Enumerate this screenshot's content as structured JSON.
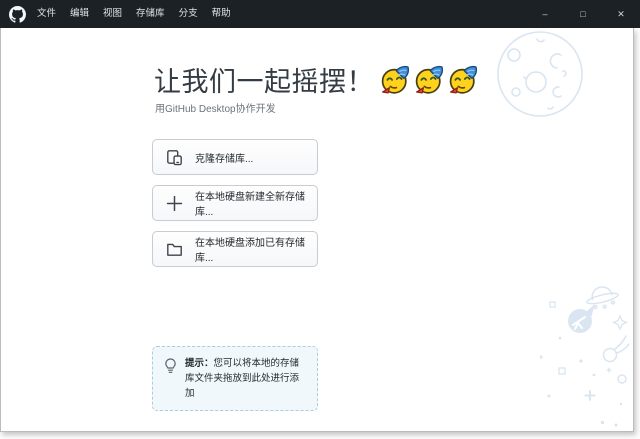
{
  "window": {
    "logo_icon": "github-octocat-logo",
    "menus": [
      {
        "label": "文件"
      },
      {
        "label": "编辑"
      },
      {
        "label": "视图"
      },
      {
        "label": "存储库"
      },
      {
        "label": "分支"
      },
      {
        "label": "帮助"
      }
    ],
    "controls": {
      "minimize": "–",
      "maximize": "□",
      "close": "✕"
    }
  },
  "hero": {
    "title": "让我们一起摇摆！",
    "emoji_char": "🥳🥳🥳",
    "emoji_name": "partying-face",
    "emoji_count": 3,
    "subtitle": "用GitHub Desktop协作开发"
  },
  "actions": [
    {
      "icon": "clone-repository-icon",
      "label": "克隆存储库..."
    },
    {
      "icon": "plus-icon",
      "label": "在本地硬盘新建全新存储库..."
    },
    {
      "icon": "folder-icon",
      "label": "在本地硬盘添加已有存储库..."
    }
  ],
  "tip": {
    "icon": "lightbulb-icon",
    "prefix": "提示：",
    "text": "您可以将本地的存储库文件夹拖放到此处进行添加"
  },
  "decorations": [
    "moon-illustration",
    "ufo",
    "telescope-bubble",
    "comet",
    "stars-and-dots"
  ],
  "colors": {
    "titlebar_bg": "#1c2126",
    "content_bg": "#ffffff",
    "button_border": "#c5ccd3",
    "tip_bg": "#f1f8fc",
    "tip_border": "#a9cce6",
    "decoration_blue": "#d9e5f1",
    "heading_text": "#333b43",
    "subtitle_text": "#6a737d"
  }
}
